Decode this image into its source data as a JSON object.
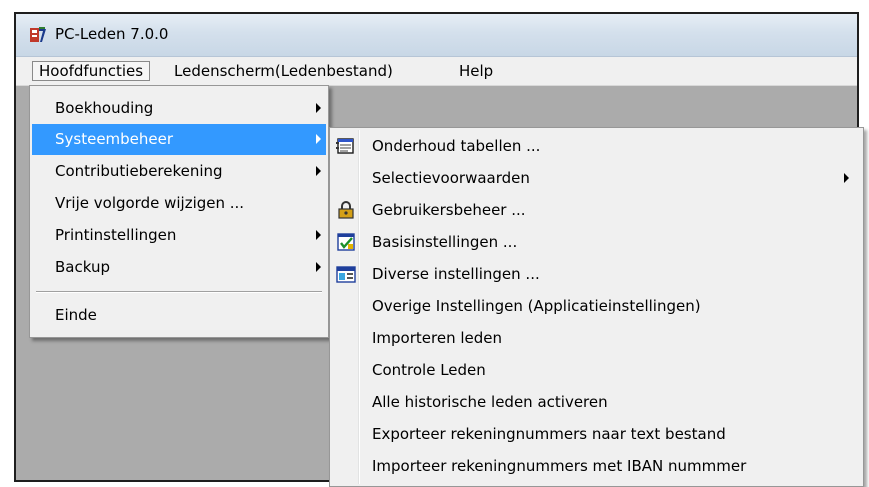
{
  "window": {
    "title": "PC-Leden 7.0.0",
    "app_icon": "pc-leden-app-icon"
  },
  "menubar": {
    "items": [
      {
        "label": "Hoofdfuncties",
        "state": "open"
      },
      {
        "label": "Ledenscherm(Ledenbestand)"
      },
      {
        "label": "Help"
      }
    ]
  },
  "main_menu": {
    "items": [
      {
        "label": "Boekhouding",
        "submenu": true
      },
      {
        "label": "Systeembeheer",
        "submenu": true,
        "highlighted": true
      },
      {
        "label": "Contributieberekening",
        "submenu": true
      },
      {
        "label": "Vrije volgorde wijzigen ..."
      },
      {
        "label": "Printinstellingen",
        "submenu": true
      },
      {
        "label": "Backup",
        "submenu": true
      },
      {
        "label": "Einde"
      }
    ]
  },
  "systeembeheer_menu": {
    "items": [
      {
        "label": "Onderhoud tabellen ...",
        "icon": "table-maintenance-icon"
      },
      {
        "label": "Selectievoorwaarden",
        "submenu": true
      },
      {
        "label": "Gebruikersbeheer ...",
        "icon": "lock-icon"
      },
      {
        "label": "Basisinstellingen ...",
        "icon": "settings-check-icon"
      },
      {
        "label": "Diverse instellingen ...",
        "icon": "window-settings-icon"
      },
      {
        "label": "Overige Instellingen (Applicatieinstellingen)"
      },
      {
        "label": "Importeren leden"
      },
      {
        "label": "Controle Leden"
      },
      {
        "label": "Alle historische leden activeren"
      },
      {
        "label": "Exporteer rekeningnummers naar text bestand"
      },
      {
        "label": "Importeer rekeningnummers met IBAN nummmer"
      }
    ]
  },
  "colors": {
    "highlight": "#3399ff",
    "menu_background": "#f0f0f0",
    "workspace": "#ababab",
    "titlebar": "#d4e0ec"
  }
}
